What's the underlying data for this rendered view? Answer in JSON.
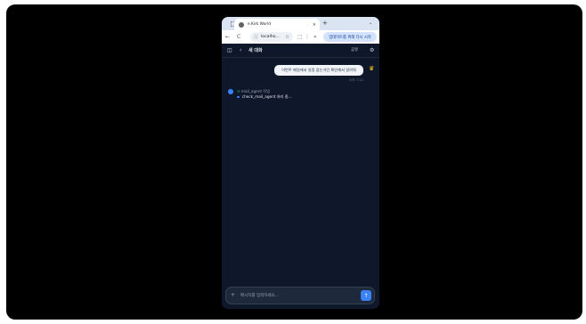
{
  "browser": {
    "inactive_tab_icon": "grid-icon",
    "active_tab": {
      "title": "e.Kirk World",
      "close": "×"
    },
    "new_tab": "+",
    "dropdown": "⌄",
    "nav": {
      "back": "←",
      "reload": "C"
    },
    "url": "localho...",
    "restart_button": "업데이트를 위해 다시 시작"
  },
  "app": {
    "header": {
      "title": "새 대화",
      "share_label": "공유"
    },
    "messages": [
      {
        "role": "user",
        "text": "이번주 메일에서 일정 잡는거던 확인해서 알려줘",
        "time": "오후 7:14"
      }
    ],
    "tool_call": {
      "agent": "mail_agent 작업",
      "status_icon": "check-icon",
      "step": "check_mail_agent 처리 중..."
    },
    "input": {
      "placeholder": "메시지를 입력하세요..."
    }
  },
  "colors": {
    "accent": "#3b82f6",
    "bg": "#0f172a"
  }
}
